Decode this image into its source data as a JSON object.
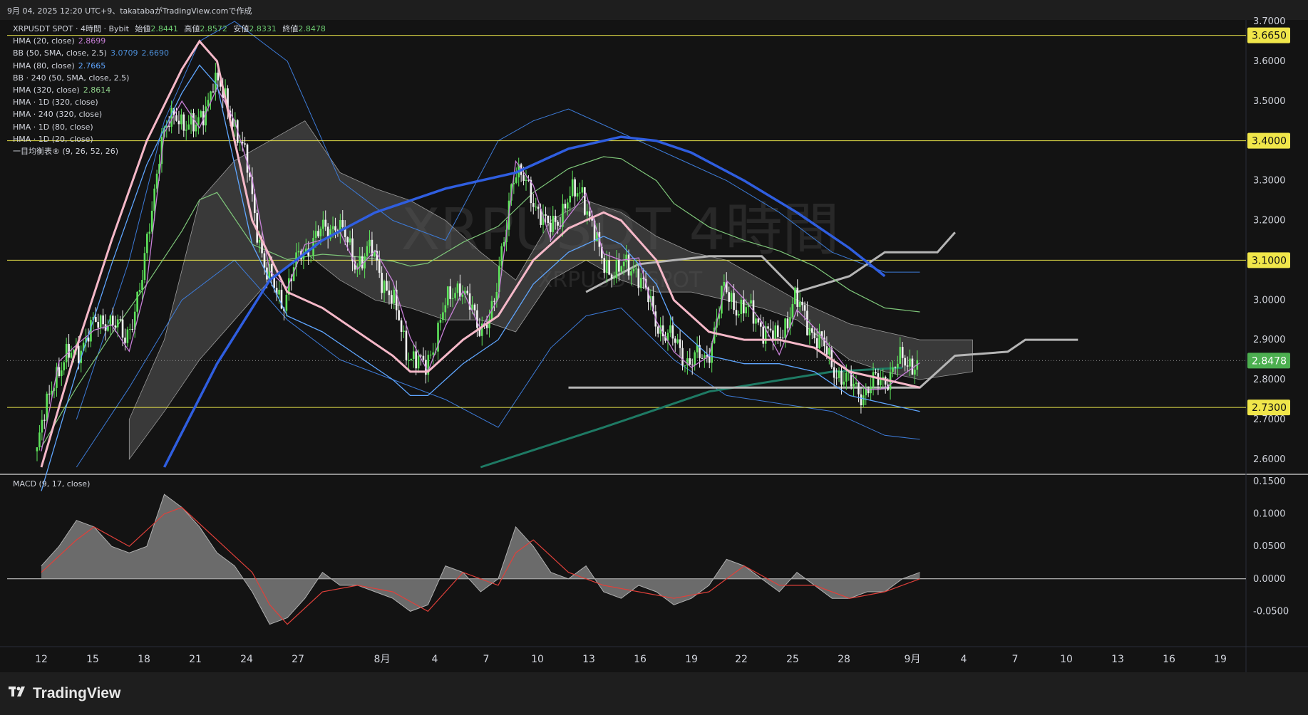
{
  "header": {
    "caption": "9月 04, 2025 12:20 UTC+9、takatabaがTradingView.comで作成"
  },
  "watermark": {
    "symbol": "XRPUSDT 4時間",
    "sub": "XRPUSDT SPOT"
  },
  "legend": {
    "title": "XRPUSDT SPOT · 4時間 · Bybit",
    "ohlc": [
      {
        "label": "始値",
        "value": "2.8441"
      },
      {
        "label": "高値",
        "value": "2.8572"
      },
      {
        "label": "安値",
        "value": "2.8331"
      },
      {
        "label": "終値",
        "value": "2.8478"
      }
    ],
    "indicators": [
      {
        "name": "HMA (20, close)",
        "value": "2.8699",
        "color": "#c880d8"
      },
      {
        "name": "BB (50, SMA, close, 2.5)",
        "value": "3.0709",
        "value2": "2.6690",
        "color": "#4d8fd9"
      },
      {
        "name": "HMA (80, close)",
        "value": "2.7665",
        "color": "#5fa6ff"
      },
      {
        "name": "BB · 240 (50, SMA, close, 2.5)",
        "value": "",
        "color": "#d1d4dc"
      },
      {
        "name": "HMA (320, close)",
        "value": "2.8614",
        "color": "#8fd18a"
      },
      {
        "name": "HMA · 1D (320, close)",
        "value": "",
        "color": "#d1d4dc"
      },
      {
        "name": "HMA · 240 (320, close)",
        "value": "",
        "color": "#d1d4dc"
      },
      {
        "name": "HMA · 1D (80, close)",
        "value": "",
        "color": "#d1d4dc"
      },
      {
        "name": "HMA · 1D (20, close)",
        "value": "",
        "color": "#d1d4dc"
      },
      {
        "name": "一目均衡表® (9, 26, 52, 26)",
        "value": "",
        "color": "#d1d4dc"
      }
    ]
  },
  "macd_label": "MACD (9, 17, close)",
  "footer": {
    "brand": "TradingView"
  },
  "chart_data": [
    {
      "type": "candlestick",
      "title": "XRPUSDT SPOT · 4時間 · Bybit",
      "ylim": [
        2.58,
        3.7
      ],
      "y_ticks": [
        "3.7000",
        "3.6000",
        "3.5000",
        "3.4000",
        "3.3000",
        "3.2000",
        "3.1000",
        "3.0000",
        "2.9000",
        "2.8000",
        "2.7000",
        "2.6000"
      ],
      "x_ticks": [
        "12",
        "15",
        "18",
        "21",
        "24",
        "27",
        "8月",
        "4",
        "7",
        "10",
        "13",
        "16",
        "19",
        "22",
        "25",
        "28",
        "9月",
        "4",
        "7",
        "10",
        "13",
        "16",
        "19"
      ],
      "price_lines": [
        {
          "value": 3.665,
          "label": "3.6650"
        },
        {
          "value": 3.4,
          "label": "3.4000"
        },
        {
          "value": 3.1,
          "label": "3.1000"
        },
        {
          "value": 2.73,
          "label": "2.7300"
        }
      ],
      "last_price": {
        "value": 2.8478,
        "label": "2.8478",
        "color": "#4caf50"
      },
      "close_path": [
        [
          0,
          2.62
        ],
        [
          1,
          2.82
        ],
        [
          2,
          2.86
        ],
        [
          3,
          2.92
        ],
        [
          4,
          2.96
        ],
        [
          5,
          2.9
        ],
        [
          6,
          3.05
        ],
        [
          7,
          3.4
        ],
        [
          8,
          3.47
        ],
        [
          9,
          3.42
        ],
        [
          10,
          3.55
        ],
        [
          11,
          3.48
        ],
        [
          12,
          3.32
        ],
        [
          13,
          3.06
        ],
        [
          14,
          3.0
        ],
        [
          15,
          3.12
        ],
        [
          16,
          3.16
        ],
        [
          17,
          3.2
        ],
        [
          18,
          3.1
        ],
        [
          19,
          3.12
        ],
        [
          20,
          3.02
        ],
        [
          21,
          2.88
        ],
        [
          22,
          2.82
        ],
        [
          23,
          2.96
        ],
        [
          24,
          3.05
        ],
        [
          25,
          2.93
        ],
        [
          26,
          2.98
        ],
        [
          27,
          3.32
        ],
        [
          28,
          3.28
        ],
        [
          29,
          3.17
        ],
        [
          30,
          3.24
        ],
        [
          31,
          3.28
        ],
        [
          32,
          3.1
        ],
        [
          33,
          3.07
        ],
        [
          34,
          3.09
        ],
        [
          35,
          2.96
        ],
        [
          36,
          2.9
        ],
        [
          37,
          2.85
        ],
        [
          38,
          2.85
        ],
        [
          39,
          3.02
        ],
        [
          40,
          2.98
        ],
        [
          41,
          2.95
        ],
        [
          42,
          2.89
        ],
        [
          43,
          3.0
        ],
        [
          44,
          2.93
        ],
        [
          45,
          2.85
        ],
        [
          46,
          2.79
        ],
        [
          47,
          2.77
        ],
        [
          48,
          2.8
        ],
        [
          49,
          2.84
        ],
        [
          50,
          2.85
        ]
      ],
      "hma_80": [
        [
          0,
          2.58
        ],
        [
          2,
          2.88
        ],
        [
          4,
          3.15
        ],
        [
          6,
          3.4
        ],
        [
          8,
          3.58
        ],
        [
          9,
          3.65
        ],
        [
          10,
          3.6
        ],
        [
          12,
          3.2
        ],
        [
          14,
          3.02
        ],
        [
          16,
          2.98
        ],
        [
          18,
          2.92
        ],
        [
          20,
          2.86
        ],
        [
          21,
          2.82
        ],
        [
          22,
          2.82
        ],
        [
          24,
          2.9
        ],
        [
          26,
          2.96
        ],
        [
          28,
          3.1
        ],
        [
          30,
          3.18
        ],
        [
          32,
          3.22
        ],
        [
          33,
          3.2
        ],
        [
          35,
          3.1
        ],
        [
          36,
          3.0
        ],
        [
          38,
          2.92
        ],
        [
          40,
          2.9
        ],
        [
          42,
          2.9
        ],
        [
          44,
          2.88
        ],
        [
          46,
          2.82
        ],
        [
          48,
          2.8
        ],
        [
          50,
          2.78
        ]
      ],
      "hma_320": [
        [
          7,
          2.58
        ],
        [
          10,
          2.84
        ],
        [
          13,
          3.05
        ],
        [
          16,
          3.15
        ],
        [
          19,
          3.22
        ],
        [
          23,
          3.28
        ],
        [
          27,
          3.32
        ],
        [
          30,
          3.38
        ],
        [
          33,
          3.41
        ],
        [
          35,
          3.4
        ],
        [
          37,
          3.37
        ],
        [
          40,
          3.3
        ],
        [
          43,
          3.22
        ],
        [
          46,
          3.13
        ],
        [
          48,
          3.06
        ]
      ],
      "hma_1d_320": [
        [
          25,
          2.58
        ],
        [
          32,
          2.68
        ],
        [
          38,
          2.77
        ],
        [
          45,
          2.82
        ],
        [
          49,
          2.83
        ]
      ],
      "hma_1d_lines": [
        [
          [
            30,
            2.78
          ],
          [
            50,
            2.78
          ],
          [
            52,
            2.86
          ],
          [
            55,
            2.87
          ],
          [
            56,
            2.9
          ],
          [
            59,
            2.9
          ]
        ],
        [
          [
            31,
            3.02
          ],
          [
            34,
            3.09
          ],
          [
            38,
            3.11
          ],
          [
            41,
            3.11
          ],
          [
            43,
            3.02
          ],
          [
            46,
            3.06
          ],
          [
            48,
            3.12
          ],
          [
            51,
            3.12
          ],
          [
            52,
            3.17
          ]
        ]
      ],
      "bb_upper": [
        [
          2,
          2.7
        ],
        [
          5,
          3.1
        ],
        [
          7,
          3.45
        ],
        [
          9,
          3.65
        ],
        [
          11,
          3.7
        ],
        [
          14,
          3.6
        ],
        [
          17,
          3.3
        ],
        [
          20,
          3.2
        ],
        [
          23,
          3.15
        ],
        [
          26,
          3.4
        ],
        [
          28,
          3.45
        ],
        [
          30,
          3.48
        ],
        [
          33,
          3.42
        ],
        [
          36,
          3.36
        ],
        [
          39,
          3.3
        ],
        [
          42,
          3.22
        ],
        [
          45,
          3.12
        ],
        [
          48,
          3.07
        ],
        [
          50,
          3.07
        ]
      ],
      "bb_lower": [
        [
          2,
          2.58
        ],
        [
          5,
          2.78
        ],
        [
          8,
          3.0
        ],
        [
          11,
          3.1
        ],
        [
          14,
          2.95
        ],
        [
          17,
          2.85
        ],
        [
          20,
          2.8
        ],
        [
          23,
          2.75
        ],
        [
          26,
          2.68
        ],
        [
          29,
          2.88
        ],
        [
          31,
          2.96
        ],
        [
          33,
          2.98
        ],
        [
          36,
          2.85
        ],
        [
          39,
          2.76
        ],
        [
          42,
          2.74
        ],
        [
          45,
          2.72
        ],
        [
          48,
          2.66
        ],
        [
          50,
          2.65
        ]
      ],
      "cloud_top": [
        [
          5,
          2.7
        ],
        [
          7,
          2.9
        ],
        [
          9,
          3.25
        ],
        [
          11,
          3.35
        ],
        [
          13,
          3.4
        ],
        [
          15,
          3.45
        ],
        [
          17,
          3.32
        ],
        [
          19,
          3.28
        ],
        [
          21,
          3.25
        ],
        [
          23,
          3.2
        ],
        [
          25,
          3.12
        ],
        [
          27,
          3.05
        ],
        [
          29,
          3.2
        ],
        [
          31,
          3.25
        ],
        [
          33,
          3.22
        ],
        [
          35,
          3.16
        ],
        [
          37,
          3.12
        ],
        [
          39,
          3.1
        ],
        [
          41,
          3.05
        ],
        [
          43,
          3.0
        ],
        [
          46,
          2.94
        ],
        [
          48,
          2.92
        ],
        [
          50,
          2.9
        ],
        [
          53,
          2.9
        ]
      ],
      "cloud_bottom": [
        [
          5,
          2.6
        ],
        [
          7,
          2.72
        ],
        [
          9,
          2.85
        ],
        [
          11,
          2.95
        ],
        [
          13,
          3.05
        ],
        [
          15,
          3.12
        ],
        [
          17,
          3.05
        ],
        [
          19,
          3.0
        ],
        [
          21,
          2.98
        ],
        [
          23,
          2.95
        ],
        [
          25,
          2.95
        ],
        [
          27,
          2.92
        ],
        [
          29,
          3.05
        ],
        [
          31,
          3.1
        ],
        [
          33,
          3.05
        ],
        [
          35,
          3.02
        ],
        [
          37,
          3.02
        ],
        [
          39,
          3.0
        ],
        [
          41,
          2.98
        ],
        [
          43,
          2.95
        ],
        [
          46,
          2.85
        ],
        [
          48,
          2.82
        ],
        [
          50,
          2.8
        ],
        [
          53,
          2.82
        ]
      ]
    },
    {
      "type": "area",
      "title": "MACD (9, 17, close)",
      "ylim": [
        -0.1,
        0.15
      ],
      "y_ticks": [
        "0.1500",
        "0.1000",
        "0.0500",
        "0.0000",
        "-0.0500"
      ],
      "macd": [
        [
          0,
          0.02
        ],
        [
          1,
          0.05
        ],
        [
          2,
          0.09
        ],
        [
          3,
          0.08
        ],
        [
          4,
          0.05
        ],
        [
          5,
          0.04
        ],
        [
          6,
          0.05
        ],
        [
          7,
          0.13
        ],
        [
          8,
          0.11
        ],
        [
          9,
          0.08
        ],
        [
          10,
          0.04
        ],
        [
          11,
          0.02
        ],
        [
          12,
          -0.02
        ],
        [
          13,
          -0.07
        ],
        [
          14,
          -0.06
        ],
        [
          15,
          -0.03
        ],
        [
          16,
          0.01
        ],
        [
          17,
          -0.01
        ],
        [
          18,
          -0.01
        ],
        [
          19,
          -0.02
        ],
        [
          20,
          -0.03
        ],
        [
          21,
          -0.05
        ],
        [
          22,
          -0.04
        ],
        [
          23,
          0.02
        ],
        [
          24,
          0.01
        ],
        [
          25,
          -0.02
        ],
        [
          26,
          0.0
        ],
        [
          27,
          0.08
        ],
        [
          28,
          0.05
        ],
        [
          29,
          0.01
        ],
        [
          30,
          0.0
        ],
        [
          31,
          0.02
        ],
        [
          32,
          -0.02
        ],
        [
          33,
          -0.03
        ],
        [
          34,
          -0.01
        ],
        [
          35,
          -0.02
        ],
        [
          36,
          -0.04
        ],
        [
          37,
          -0.03
        ],
        [
          38,
          -0.01
        ],
        [
          39,
          0.03
        ],
        [
          40,
          0.02
        ],
        [
          41,
          0.0
        ],
        [
          42,
          -0.02
        ],
        [
          43,
          0.01
        ],
        [
          44,
          -0.01
        ],
        [
          45,
          -0.03
        ],
        [
          46,
          -0.03
        ],
        [
          47,
          -0.02
        ],
        [
          48,
          -0.02
        ],
        [
          49,
          0.0
        ],
        [
          50,
          0.01
        ]
      ],
      "signal": [
        [
          0,
          0.01
        ],
        [
          2,
          0.06
        ],
        [
          3,
          0.08
        ],
        [
          5,
          0.05
        ],
        [
          7,
          0.1
        ],
        [
          8,
          0.11
        ],
        [
          10,
          0.06
        ],
        [
          12,
          0.01
        ],
        [
          13,
          -0.04
        ],
        [
          14,
          -0.07
        ],
        [
          16,
          -0.02
        ],
        [
          18,
          -0.01
        ],
        [
          20,
          -0.02
        ],
        [
          22,
          -0.05
        ],
        [
          24,
          0.01
        ],
        [
          26,
          -0.01
        ],
        [
          27,
          0.04
        ],
        [
          28,
          0.06
        ],
        [
          30,
          0.01
        ],
        [
          32,
          -0.01
        ],
        [
          34,
          -0.02
        ],
        [
          36,
          -0.03
        ],
        [
          38,
          -0.02
        ],
        [
          40,
          0.02
        ],
        [
          42,
          -0.01
        ],
        [
          44,
          -0.01
        ],
        [
          46,
          -0.03
        ],
        [
          48,
          -0.02
        ],
        [
          50,
          0.0
        ]
      ]
    }
  ]
}
